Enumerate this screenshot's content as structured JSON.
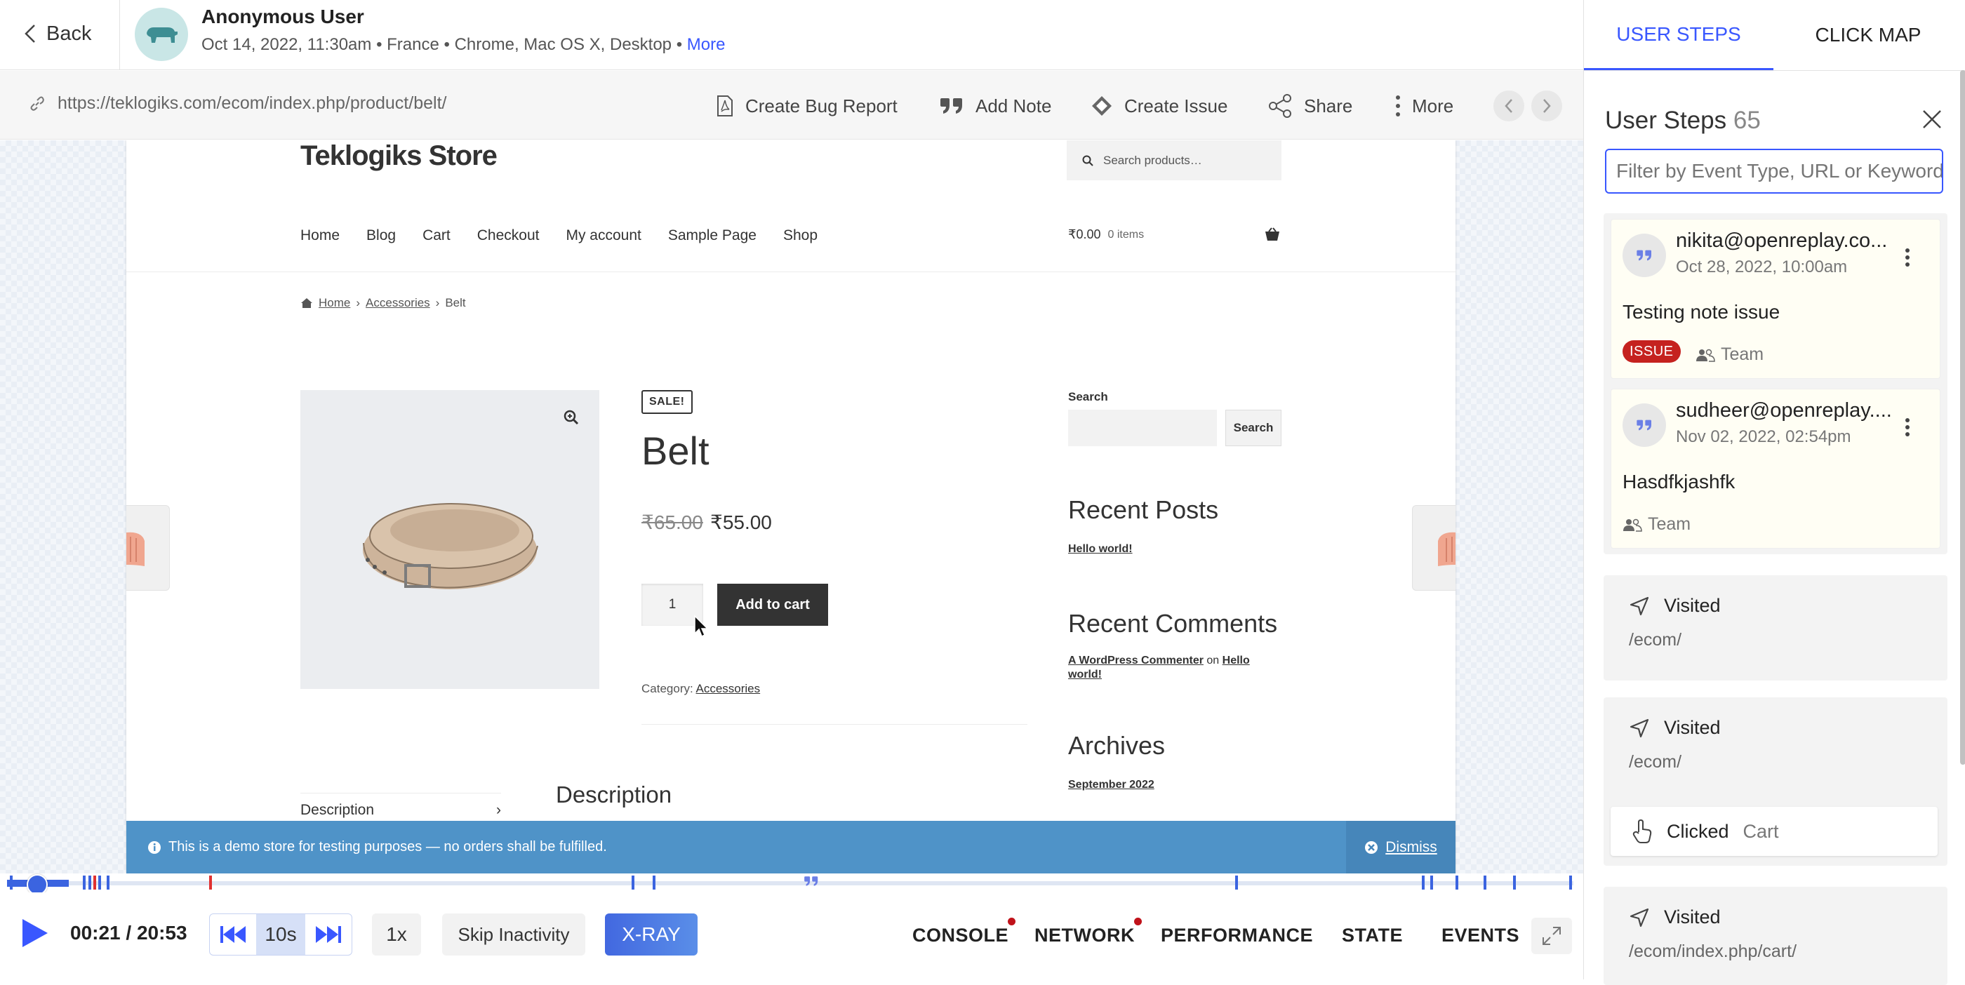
{
  "header": {
    "back_label": "Back",
    "user_name": "Anonymous User",
    "date": "Oct 14, 2022, 11:30am",
    "country": "France",
    "device": "Chrome, Mac OS X, Desktop",
    "more_label": "More"
  },
  "urlbar": {
    "url": "https://teklogiks.com/ecom/index.php/product/belt/",
    "create_bug_report": "Create Bug Report",
    "add_note": "Add Note",
    "create_issue": "Create Issue",
    "share": "Share",
    "more": "More"
  },
  "site": {
    "store_name": "Teklogiks Store",
    "search_placeholder": "Search products…",
    "menu": [
      "Home",
      "Blog",
      "Cart",
      "Checkout",
      "My account",
      "Sample Page",
      "Shop"
    ],
    "cart_total": "₹0.00",
    "cart_items": "0 items",
    "breadcrumb": [
      "Home",
      "Accessories",
      "Belt"
    ],
    "sale_badge": "SALE!",
    "product_title": "Belt",
    "old_price": "₹65.00",
    "new_price": "₹55.00",
    "quantity": "1",
    "add_to_cart": "Add to cart",
    "category_label": "Category:",
    "category_value": "Accessories",
    "desc_tab": "Description",
    "desc_heading": "Description",
    "sidebar": {
      "search_label": "Search",
      "search_button": "Search",
      "recent_posts_title": "Recent Posts",
      "recent_post": "Hello world!",
      "recent_comments_title": "Recent Comments",
      "commenter": "A WordPress Commenter",
      "comment_on": "on",
      "comment_post_a": "Hello",
      "comment_post_b": "world!",
      "archives_title": "Archives",
      "archive_month": "September 2022"
    },
    "notice": "This is a demo store for testing purposes — no orders shall be fulfilled.",
    "dismiss": "Dismiss"
  },
  "player": {
    "time": "00:21 / 20:53",
    "skip_interval": "10s",
    "speed": "1x",
    "skip_inactivity": "Skip Inactivity",
    "xray": "X-RAY",
    "tabs": [
      "CONSOLE",
      "NETWORK",
      "PERFORMANCE",
      "STATE",
      "EVENTS"
    ],
    "progress": 0.017
  },
  "right_panel": {
    "tab_user_steps": "USER STEPS",
    "tab_click_map": "CLICK MAP",
    "title": "User Steps",
    "count": "65",
    "filter_placeholder": "Filter by Event Type, URL or Keyword",
    "notes": [
      {
        "author": "nikita@openreplay.co...",
        "date": "Oct 28, 2022, 10:00am",
        "text": "Testing note issue",
        "badge": "ISSUE",
        "visibility": "Team"
      },
      {
        "author": "sudheer@openreplay....",
        "date": "Nov 02, 2022, 02:54pm",
        "text": "Hasdfkjashfk",
        "visibility": "Team"
      }
    ],
    "steps": [
      {
        "type": "Visited",
        "url": "/ecom/"
      },
      {
        "type": "Visited",
        "url": "/ecom/",
        "sub_type": "Clicked",
        "sub_target": "Cart"
      },
      {
        "type": "Visited",
        "url": "/ecom/index.php/cart/"
      }
    ]
  },
  "colors": {
    "accent": "#3957ff",
    "issue_badge": "#c5221f",
    "notice_bar": "#4f93c8",
    "timeline": "#3b64e0"
  }
}
